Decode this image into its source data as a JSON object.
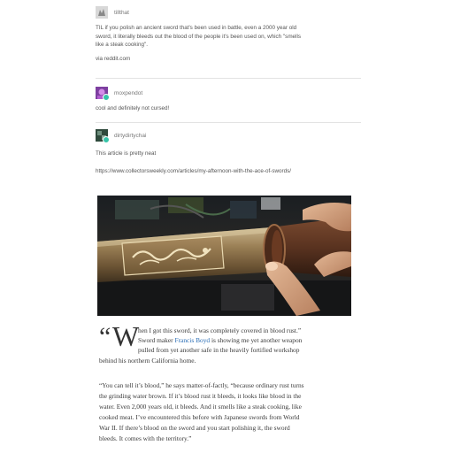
{
  "posts": [
    {
      "username": "tillthat",
      "text_lines": [
        "TIL if you polish an ancient sword that's been used in battle, even a 2000 year old",
        "sword, it literally bleeds out the blood of the people it's been used on, which \"smells",
        "like a steak cooking\"."
      ],
      "via": "via reddit.com",
      "avatar_color": "#cfcfcf"
    },
    {
      "username": "moxpendot",
      "text": "cool and definitely not cursed!",
      "avatar_color": "#9b59b6"
    },
    {
      "username": "dirtydirtychai",
      "text": "This article is pretty neat",
      "url": "https://www.collectorsweekly.com/articles/my-afternoon-with-the-ace-of-swords/",
      "avatar_color": "#3d5a4a"
    }
  ],
  "article": {
    "quote_mark": "“",
    "drop_cap": "W",
    "lines": [
      "hen I got this sword, it was completely covered in blood rust.”",
      "Sword maker ",
      "Francis Boyd",
      " is showing me yet another weapon",
      "pulled from yet another safe in the heavily fortified workshop",
      "behind his northern California home.",
      "“You can tell it’s blood,” he says matter-of-factly, “because ordinary rust turns",
      "the grinding water brown. If it’s blood rust it bleeds, it looks like blood in the",
      "water. Even 2,000 years old, it bleeds. And it smells like a steak cooking, like",
      "cooked meat. I’ve encountered this before with Japanese swords from World",
      "War II. If there’s blood on the sword and you start polishing it, the sword",
      "bleeds. It comes with the territory.”"
    ]
  },
  "colors": {
    "link": "#2a6db5",
    "divider": "#e3e3e3",
    "badge": "#36c4a8"
  }
}
